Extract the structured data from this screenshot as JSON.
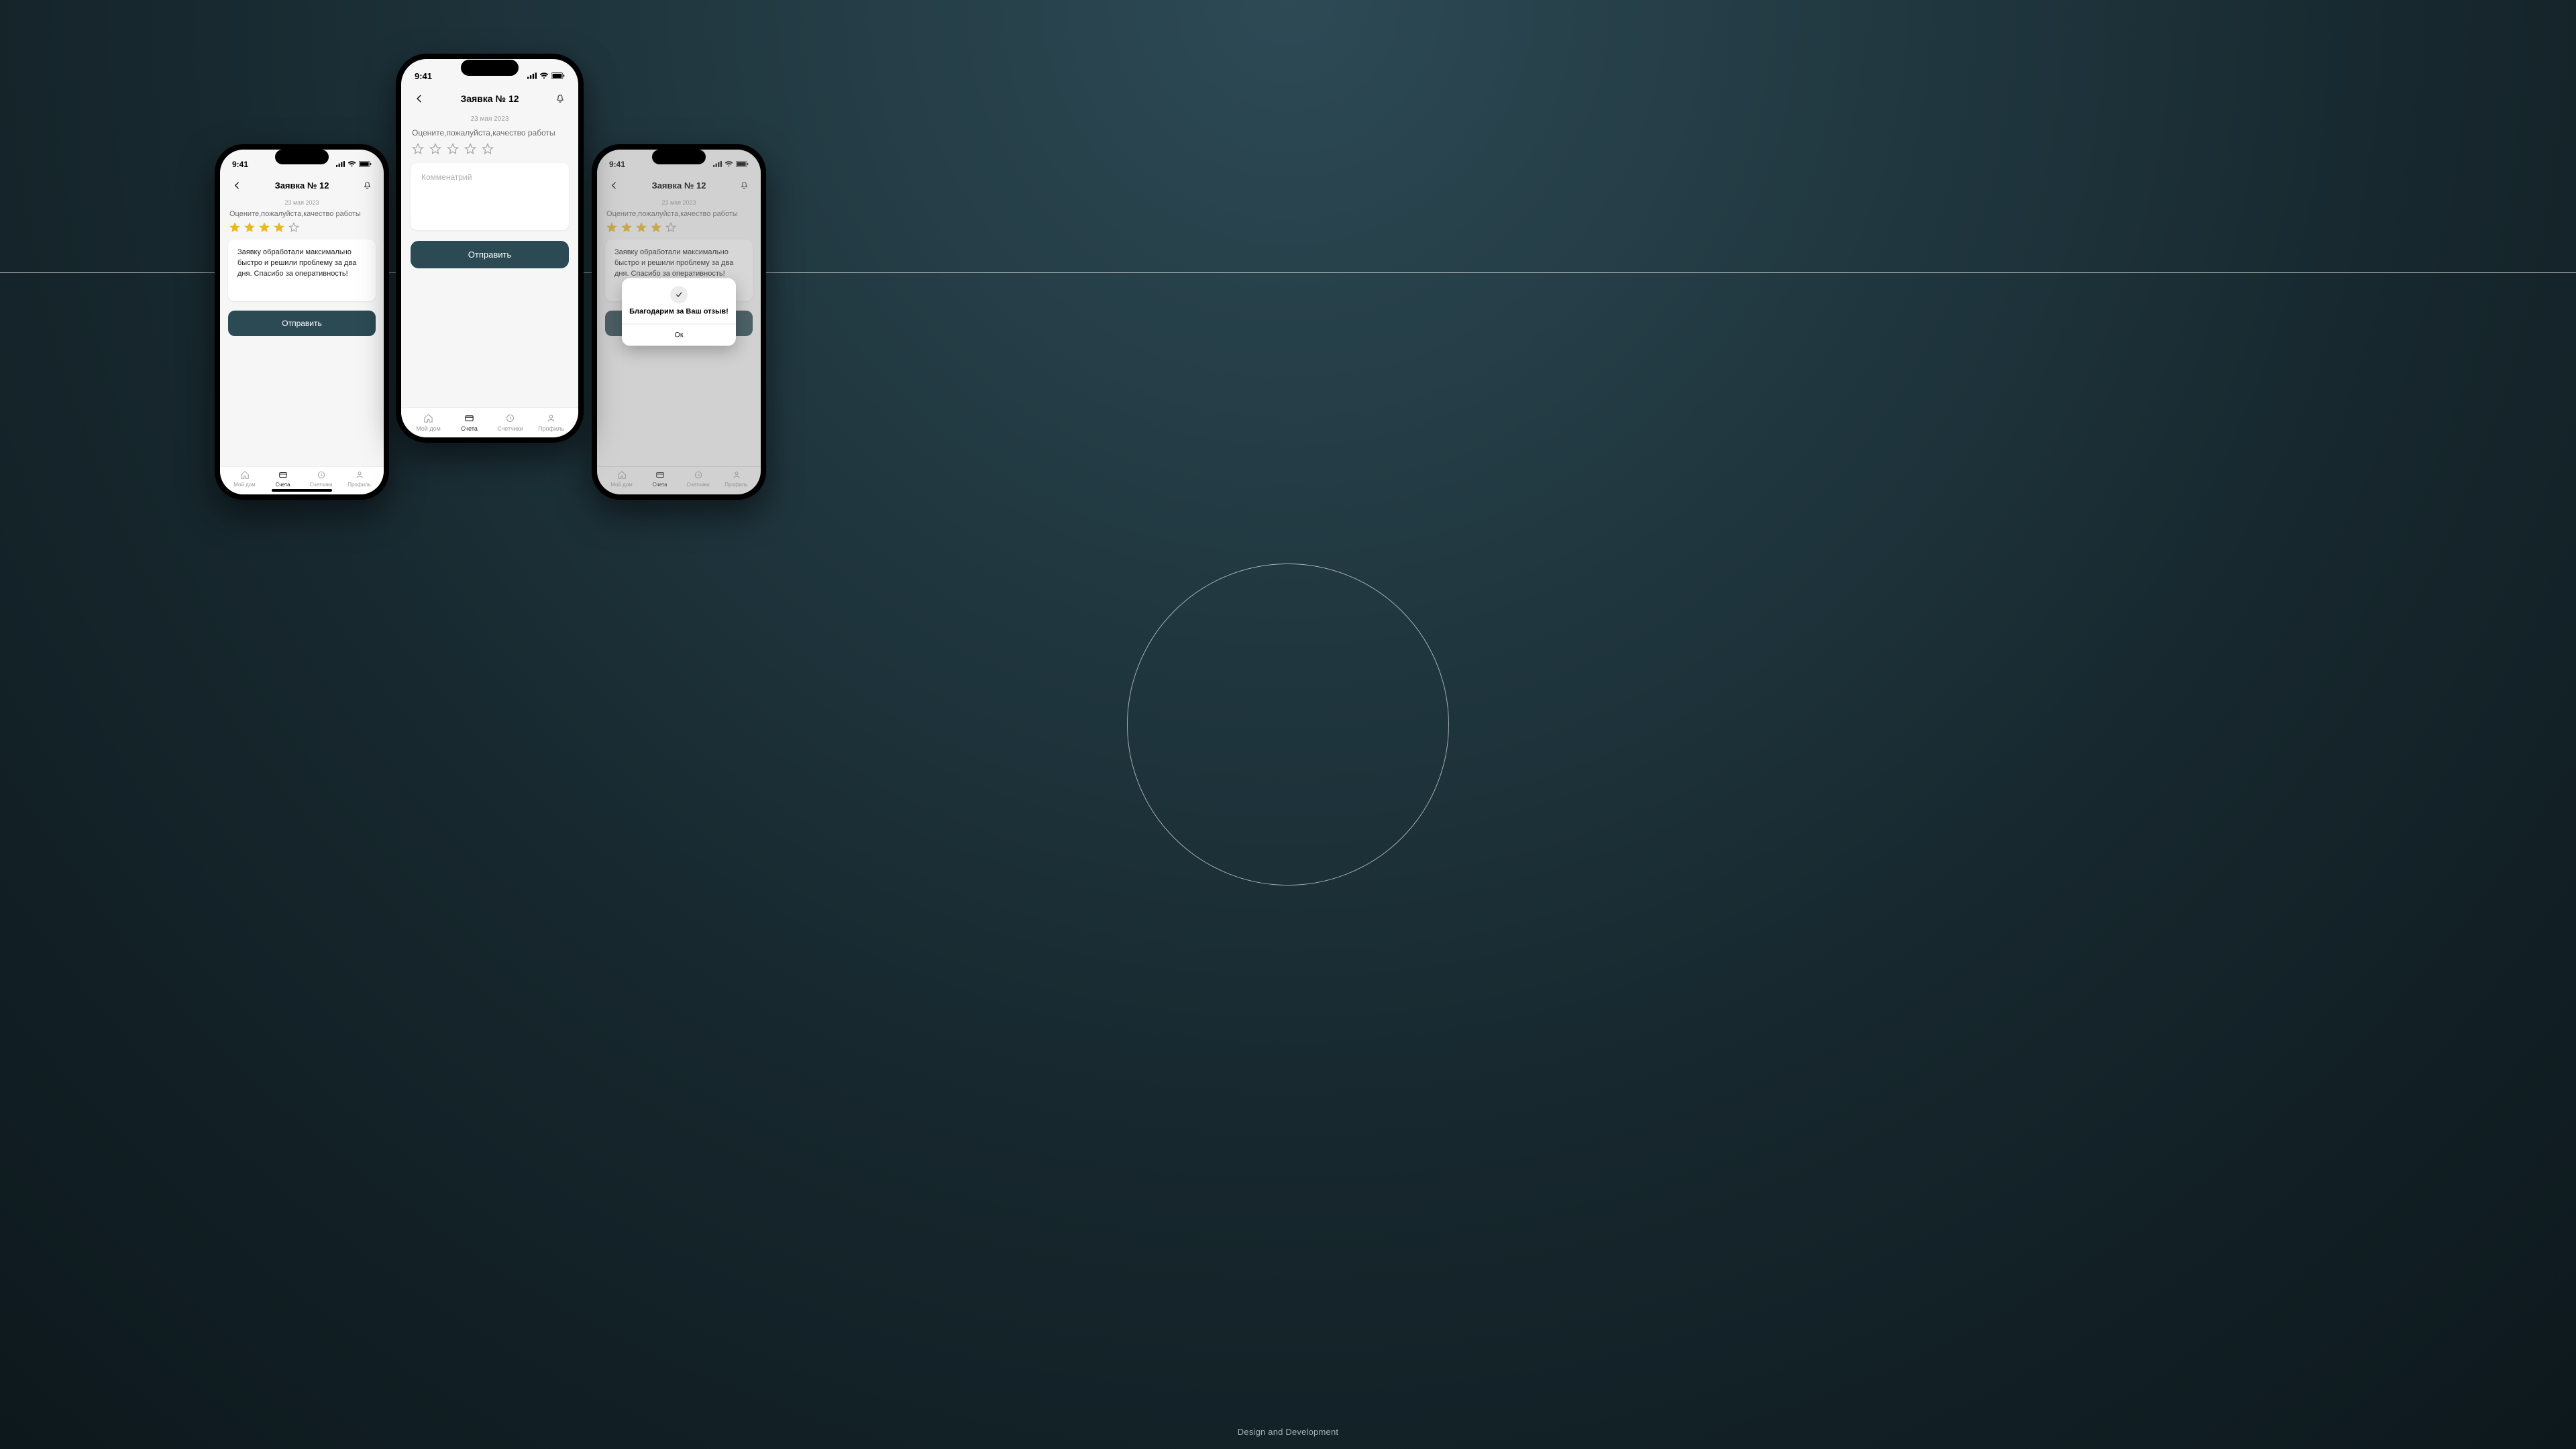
{
  "caption": "Design and Development",
  "status": {
    "time": "9:41"
  },
  "nav": {
    "title": "Заявка №  12"
  },
  "date": "23 мая 2023",
  "prompt": "Оцените,пожалуйста,качество работы",
  "rating": {
    "filled": 4,
    "empty": 1,
    "emptyAll": 5
  },
  "comment_filled": "Заявку обработали максимально быстро и решили проблему за два дня. Спасибо за оперативность!",
  "comment_placeholder": "Комменатрий",
  "submit_label": "Отправить",
  "modal": {
    "title": "Благодарим за Ваш отзыв!",
    "ok": "Ок"
  },
  "tabs": [
    {
      "label": "Мой дом"
    },
    {
      "label": "Счета"
    },
    {
      "label": "Счетчики"
    },
    {
      "label": "Профиль"
    }
  ]
}
